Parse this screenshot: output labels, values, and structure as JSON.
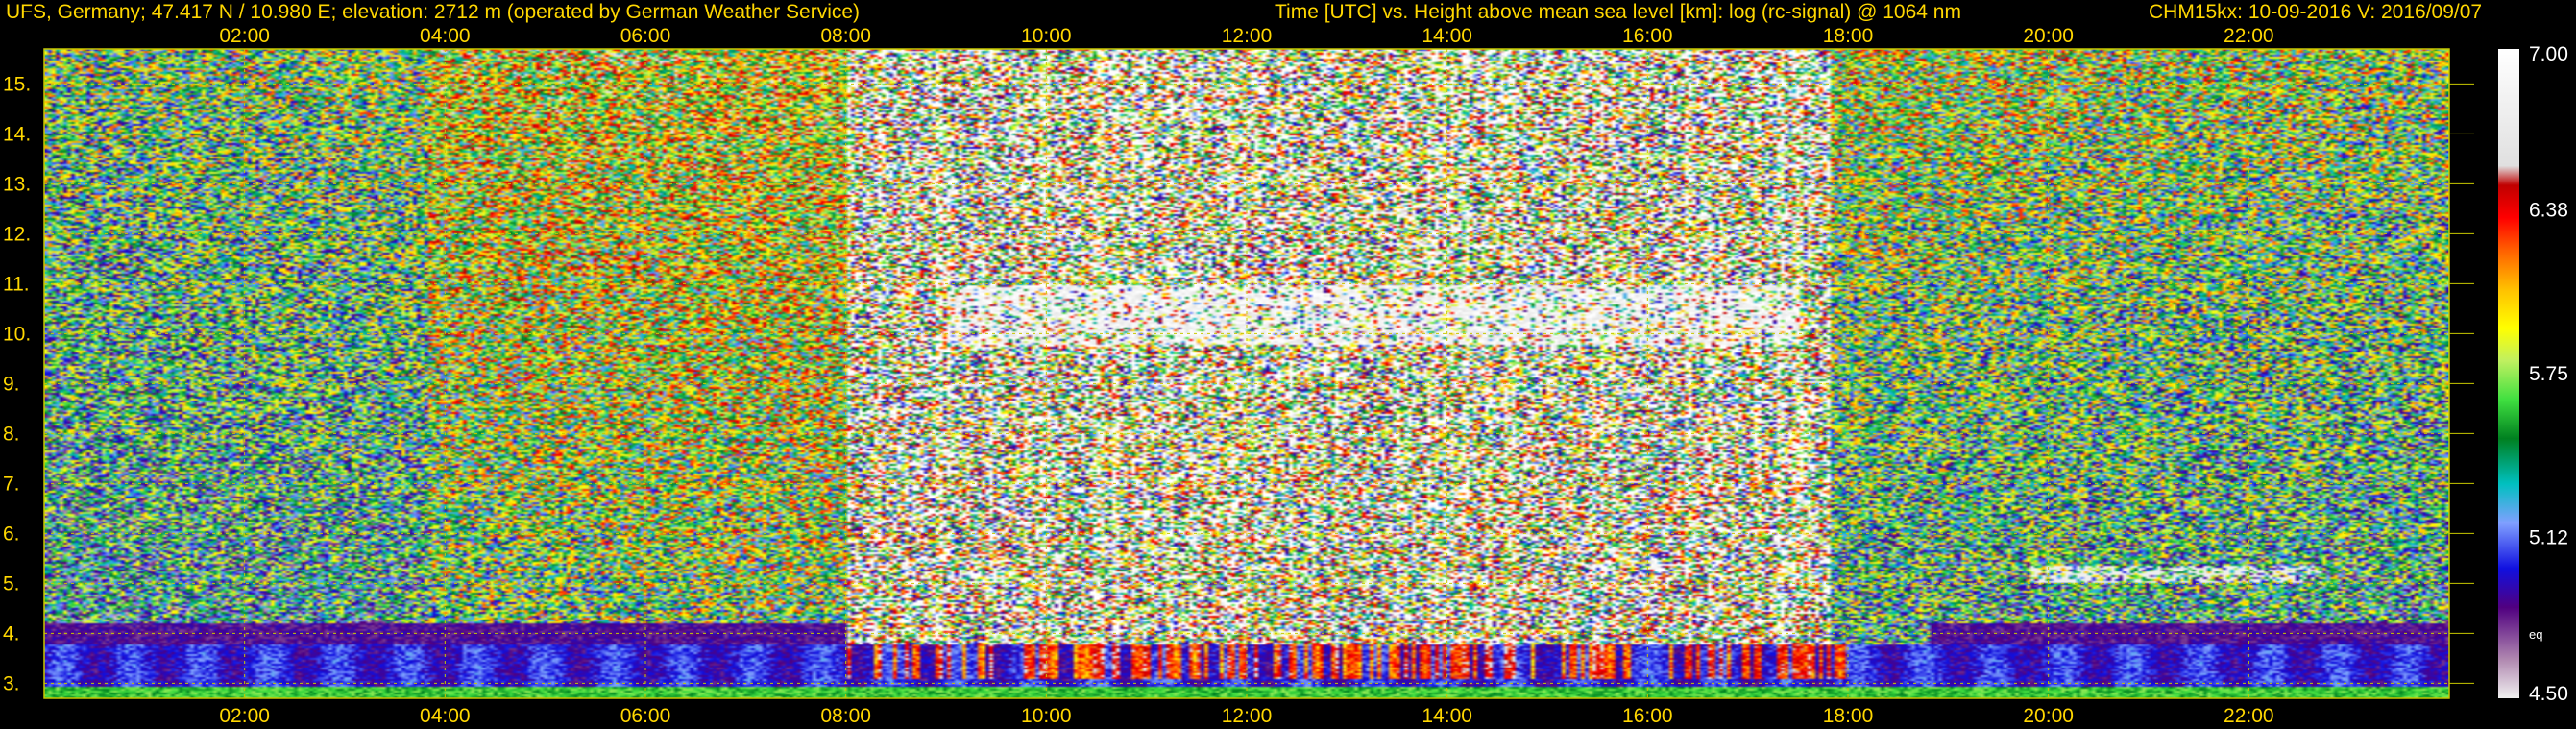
{
  "header": {
    "site_info": "UFS, Germany; 47.417 N / 10.980 E; elevation: 2712 m  (operated by German Weather Service)",
    "plot_info": "Time [UTC] vs. Height above mean sea level [km]: log (rc-signal) @ 1064 nm",
    "instrument_info": "CHM15kx: 10-09-2016  V: 2016/09/07"
  },
  "chart_data": {
    "type": "heatmap",
    "x_ticks": [
      "02:00",
      "04:00",
      "06:00",
      "08:00",
      "10:00",
      "12:00",
      "14:00",
      "16:00",
      "18:00",
      "20:00",
      "22:00"
    ],
    "xlim": [
      0,
      24
    ],
    "y_ticks": [
      "3.",
      "4.",
      "5.",
      "6.",
      "7.",
      "8.",
      "9.",
      "10.",
      "11.",
      "12.",
      "13.",
      "14.",
      "15."
    ],
    "ylim": [
      2.7,
      15.7
    ],
    "grid": true,
    "colorbar": {
      "ticks": [
        "7.00",
        "6.38",
        "5.75",
        "5.12",
        "4.50"
      ],
      "range": [
        4.5,
        7.0
      ],
      "label": "eq"
    },
    "colors": {
      "grid": "#c8c800",
      "text": "#ffd700",
      "background": "#000000"
    },
    "features": {
      "boundary_layer_top_km": 3.8,
      "cirrus_layer_km": [
        9.8,
        11.0
      ],
      "cirrus_hours": [
        9.0,
        17.5
      ],
      "high_noise_hours": [
        8.0,
        17.8
      ],
      "evening_cloud_km": 5.2,
      "evening_cloud_hours": [
        19.8,
        22.7
      ]
    }
  }
}
